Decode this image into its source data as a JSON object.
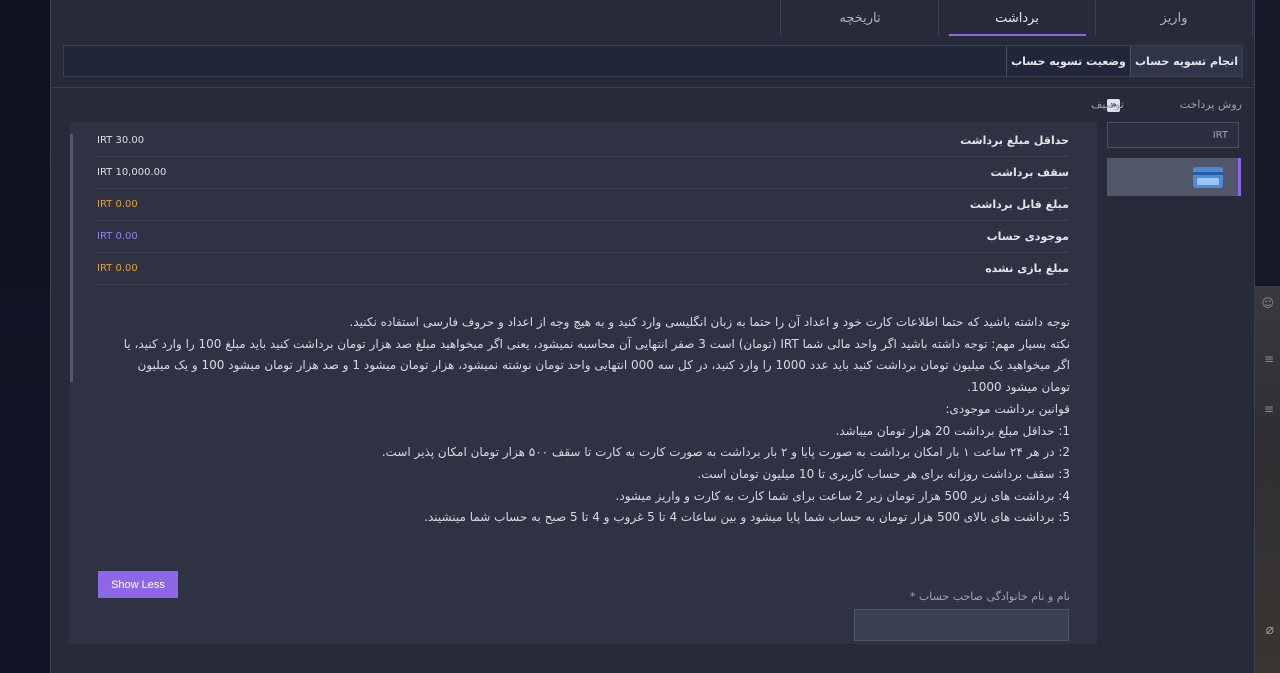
{
  "tabs": [
    {
      "label": "واریز",
      "active": false
    },
    {
      "label": "برداشت",
      "active": true
    },
    {
      "label": "تاریخچه",
      "active": false
    }
  ],
  "subtabs": {
    "settle": "انجام تسویه حساب",
    "status": "وضعیت تسویه حساب"
  },
  "payment_method": {
    "label": "روش پرداخت",
    "currency": "IRT"
  },
  "description": {
    "label": "توصیف",
    "collapse_icon": "double-chevron-right-icon"
  },
  "info_rows": [
    {
      "label": "حداقل مبلغ برداشت",
      "value": "IRT 30.00",
      "color": "#dcdfe6"
    },
    {
      "label": "سقف برداشت",
      "value": "IRT 10,000.00",
      "color": "#dcdfe6"
    },
    {
      "label": "مبلغ قابل برداشت",
      "value": "IRT 0.00",
      "color": "#e0a23c"
    },
    {
      "label": "موجودی حساب",
      "value": "IRT 0.00",
      "color": "#9d7ef0"
    },
    {
      "label": "مبلغ بازی نشده",
      "value": "IRT 0.00",
      "color": "#e0a23c"
    }
  ],
  "notice": {
    "line1": "توجه داشته باشید که حتما اطلاعات کارت خود و اعداد آن را حتما به زبان انگلیسی وارد کنید و به هیچ وجه از اعداد و حروف فارسی استفاده نکنید.",
    "line2": "نکته بسیار مهم: توجه داشته باشید اگر واحد مالی شما IRT (تومان) است 3 صفر انتهایی آن محاسبه نمیشود، یعنی اگر میخواهید مبلغ صد هزار تومان برداشت کنید باید مبلغ 100 را وارد کنید، یا اگر میخواهید یک میلیون تومان برداشت کنید باید عدد 1000 را وارد کنید، در کل سه 000 انتهایی واحد تومان نوشته نمیشود، هزار تومان میشود 1 و صد هزار تومان میشود 100 و یک  میلیون تومان میشود 1000.",
    "rules_title": "قوانین برداشت موجودی:",
    "rules": [
      "1: حداقل مبلغ برداشت 20 هزار تومان میباشد.",
      "2: در هر ۲۴ ساعت ۱ بار امکان برداشت به صورت پایا و ۲ بار برداشت به صورت کارت به کارت تا سقف ۵۰۰ هزار تومان امکان پذیر است.",
      "3: سقف برداشت روزانه برای هر حساب کاربری تا 10 میلیون تومان است.",
      "4: برداشت های زیر 500 هزار تومان زیر 2 ساعت برای شما کارت به کارت و واریز میشود.",
      "5: برداشت های بالای 500 هزار تومان به حساب شما پایا میشود و بین ساعات 4 تا 5 غروب و 4 تا 5 صبح به حساب شما مینشیند."
    ]
  },
  "show_less": "Show Less",
  "owner_field": {
    "label": "نام و نام خانوادگی صاحب حساب *",
    "value": ""
  },
  "colors": {
    "accent": "#8c67e6",
    "orange": "#e0a23c",
    "purple_value": "#9d7ef0"
  }
}
